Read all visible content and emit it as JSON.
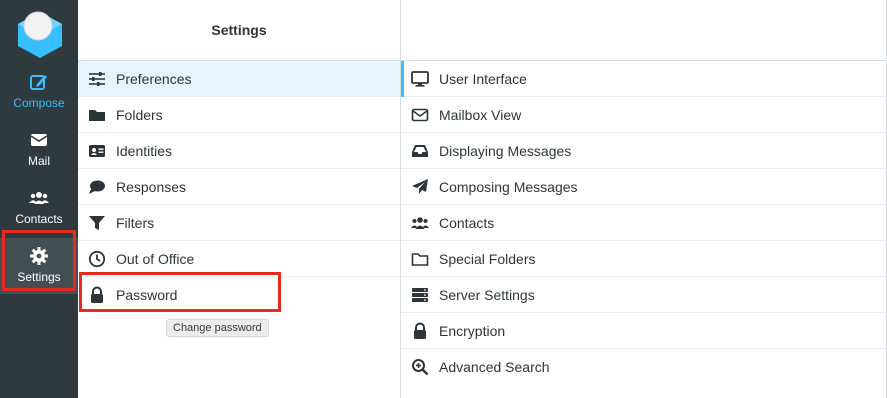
{
  "rail": {
    "items": [
      {
        "label": "Compose",
        "icon": "compose-icon"
      },
      {
        "label": "Mail",
        "icon": "mail-icon"
      },
      {
        "label": "Contacts",
        "icon": "contacts-icon"
      },
      {
        "label": "Settings",
        "icon": "gear-icon"
      }
    ]
  },
  "settings_panel": {
    "title": "Settings",
    "items": [
      {
        "label": "Preferences",
        "icon": "sliders-icon"
      },
      {
        "label": "Folders",
        "icon": "folder-icon"
      },
      {
        "label": "Identities",
        "icon": "id-card-icon"
      },
      {
        "label": "Responses",
        "icon": "comment-icon"
      },
      {
        "label": "Filters",
        "icon": "filter-icon"
      },
      {
        "label": "Out of Office",
        "icon": "clock-icon"
      },
      {
        "label": "Password",
        "icon": "lock-icon"
      }
    ],
    "tooltip": "Change password"
  },
  "preferences_panel": {
    "items": [
      {
        "label": "User Interface",
        "icon": "monitor-icon"
      },
      {
        "label": "Mailbox View",
        "icon": "envelope-icon"
      },
      {
        "label": "Displaying Messages",
        "icon": "inbox-icon"
      },
      {
        "label": "Composing Messages",
        "icon": "paper-plane-icon"
      },
      {
        "label": "Contacts",
        "icon": "users-icon"
      },
      {
        "label": "Special Folders",
        "icon": "folder-outline-icon"
      },
      {
        "label": "Server Settings",
        "icon": "server-icon"
      },
      {
        "label": "Encryption",
        "icon": "lock-icon"
      },
      {
        "label": "Advanced Search",
        "icon": "search-plus-icon"
      }
    ]
  },
  "colors": {
    "rail_bg": "#2f3a3f",
    "accent": "#37beff",
    "highlight_box": "#e32b20",
    "selected_bg": "#e5f5fd"
  }
}
